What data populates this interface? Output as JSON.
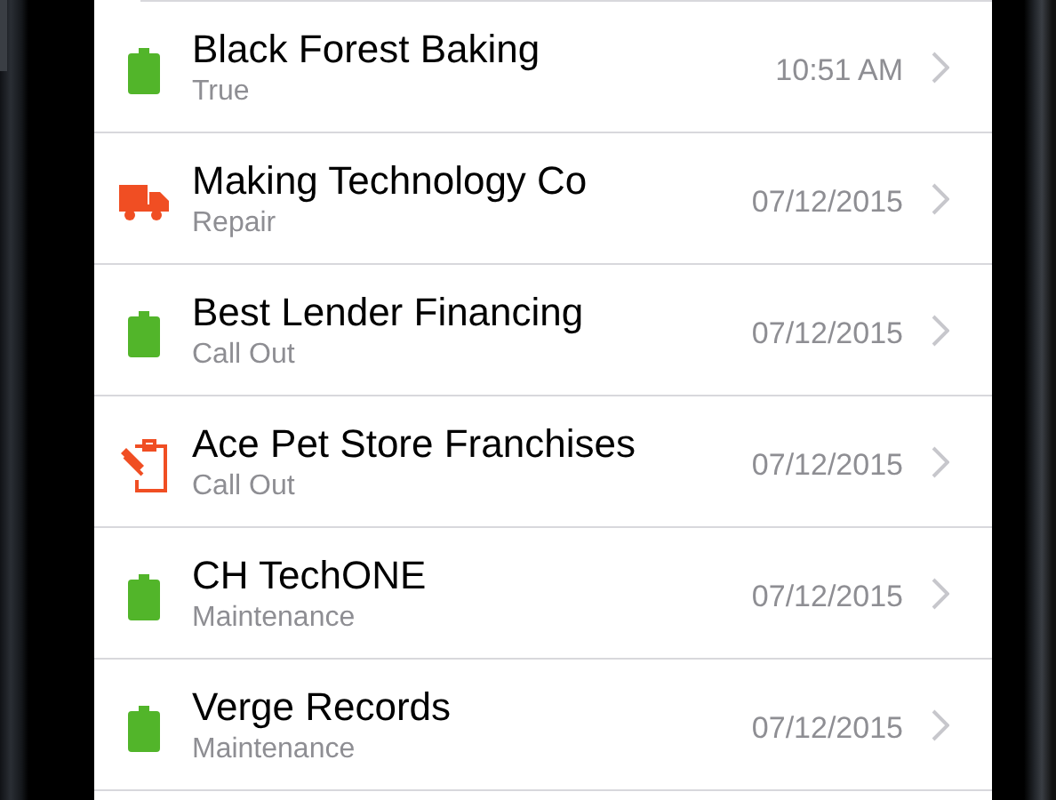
{
  "rows": [
    {
      "kind": "clipboard",
      "title": "Black Forest Baking",
      "subtitle": "True",
      "time": "10:51 AM"
    },
    {
      "kind": "truck",
      "title": "Making Technology Co",
      "subtitle": "Repair",
      "time": "07/12/2015"
    },
    {
      "kind": "clipboard",
      "title": "Best Lender Financing",
      "subtitle": "Call Out",
      "time": "07/12/2015"
    },
    {
      "kind": "clipboard-edit",
      "title": "Ace Pet Store Franchises",
      "subtitle": "Call Out",
      "time": "07/12/2015"
    },
    {
      "kind": "clipboard",
      "title": "CH TechONE",
      "subtitle": "Maintenance",
      "time": "07/12/2015"
    },
    {
      "kind": "clipboard",
      "title": "Verge Records",
      "subtitle": "Maintenance",
      "time": "07/12/2015"
    }
  ]
}
